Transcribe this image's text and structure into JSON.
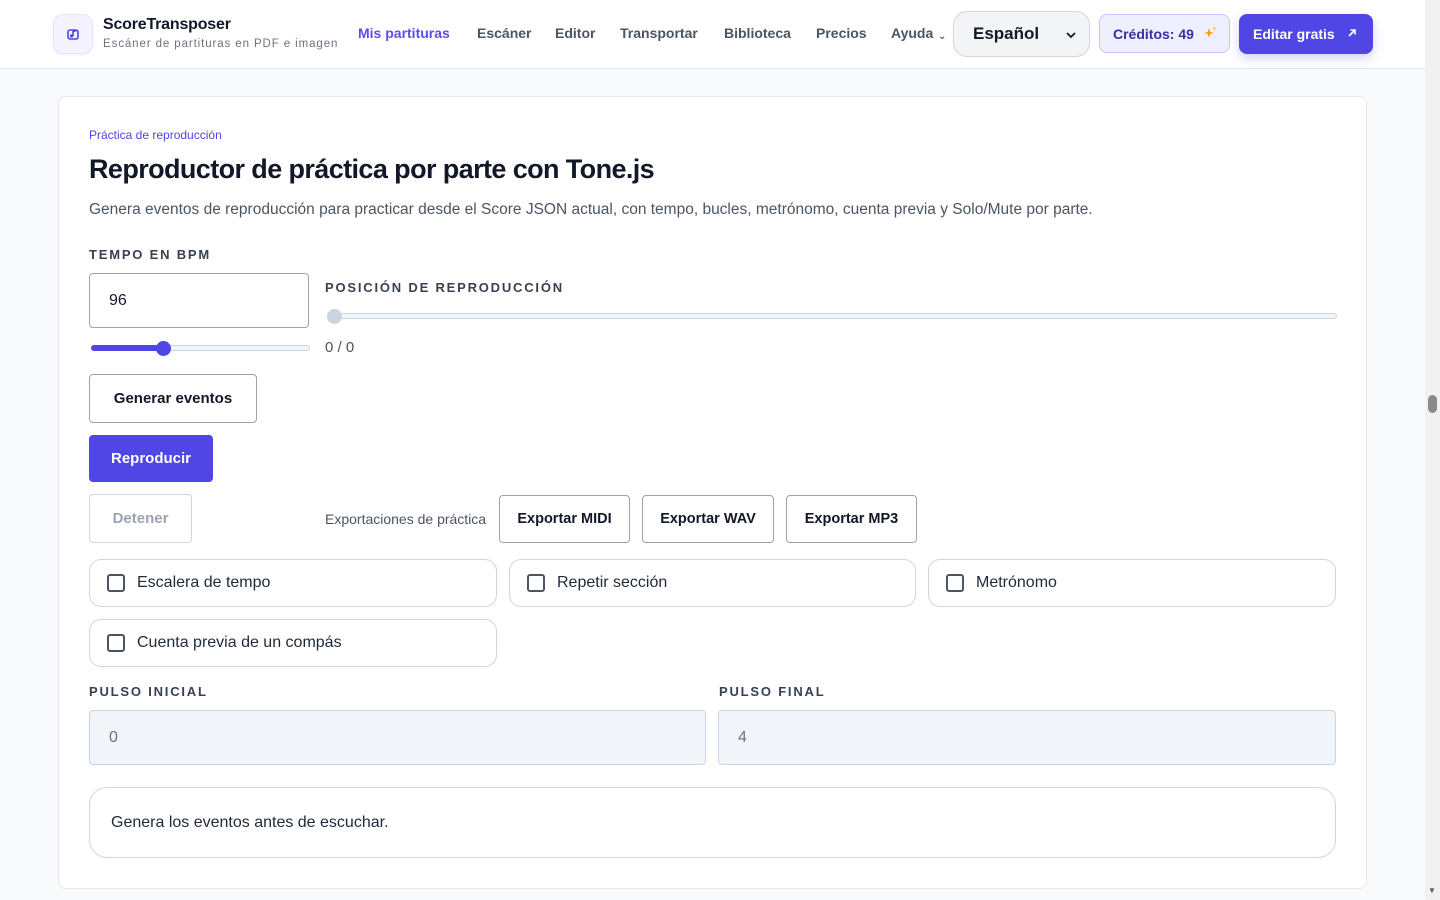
{
  "header": {
    "brand_name": "ScoreTransposer",
    "brand_tagline": "Escáner de partituras en PDF e imagen",
    "nav": [
      {
        "label": "Mis partituras",
        "active": true
      },
      {
        "label": "Escáner"
      },
      {
        "label": "Editor"
      },
      {
        "label": "Transportar"
      },
      {
        "label": "Biblioteca"
      },
      {
        "label": "Precios"
      },
      {
        "label": "Ayuda"
      }
    ],
    "language": "Español",
    "credits_label": "Créditos: 49",
    "cta_label": "Editar gratis"
  },
  "colors": {
    "accent": "#4f46e5",
    "spark": "#f59e0b"
  },
  "player": {
    "eyebrow": "Práctica de reproducción",
    "title": "Reproductor de práctica por parte con Tone.js",
    "description": "Genera eventos de reproducción para practicar desde el Score JSON actual, con tempo, bucles, metrónomo, cuenta previa y Solo/Mute por parte.",
    "tempo_label": "TEMPO EN BPM",
    "tempo_value": "96",
    "tempo_slider_fraction": 0.32,
    "position_label": "POSICIÓN DE REPRODUCCIÓN",
    "position_slider_fraction": 0,
    "position_readout": "0 / 0",
    "generate_label": "Generar eventos",
    "play_label": "Reproducir",
    "stop_label": "Detener",
    "exports_label": "Exportaciones de práctica",
    "export_midi": "Exportar MIDI",
    "export_wav": "Exportar WAV",
    "export_mp3": "Exportar MP3",
    "options": [
      {
        "label": "Escalera de tempo",
        "checked": false
      },
      {
        "label": "Repetir sección",
        "checked": false
      },
      {
        "label": "Metrónomo",
        "checked": false
      },
      {
        "label": "Cuenta previa de un compás",
        "checked": false
      }
    ],
    "start_label": "PULSO INICIAL",
    "start_value": "0",
    "end_label": "PULSO FINAL",
    "end_value": "4",
    "status": "Genera los eventos antes de escuchar."
  }
}
